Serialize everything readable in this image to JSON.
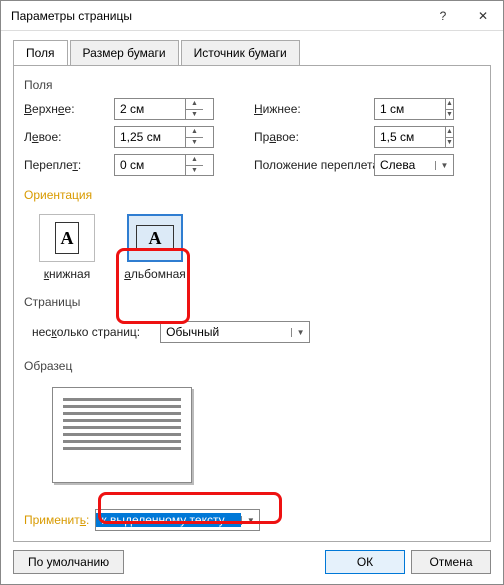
{
  "title": "Параметры страницы",
  "tabs": {
    "fields": "Поля",
    "paper": "Размер бумаги",
    "source": "Источник бумаги"
  },
  "groups": {
    "fields": "Поля",
    "orientation": "Ориентация",
    "pages": "Страницы",
    "sample": "Образец"
  },
  "margins": {
    "top_label": "Верхнее:",
    "top_value": "2 см",
    "left_label": "Левое:",
    "left_value": "1,25 см",
    "gutter_label": "Переплет:",
    "gutter_value": "0 см",
    "bottom_label": "Нижнее:",
    "bottom_value": "1 см",
    "right_label": "Правое:",
    "right_value": "1,5 см",
    "gutter_pos_label": "Положение переплета:",
    "gutter_pos_value": "Слева"
  },
  "orientation": {
    "portrait": "книжная",
    "landscape": "альбомная",
    "selected": "landscape"
  },
  "pages": {
    "label": "несколько страниц:",
    "value": "Обычный"
  },
  "apply": {
    "label": "Применить:",
    "value": "к выделенному тексту"
  },
  "buttons": {
    "default": "По умолчанию",
    "ok": "ОК",
    "cancel": "Отмена"
  },
  "icons": {
    "help": "?",
    "close": "✕",
    "up": "▲",
    "down": "▼",
    "drop": "▼",
    "letter": "A"
  }
}
